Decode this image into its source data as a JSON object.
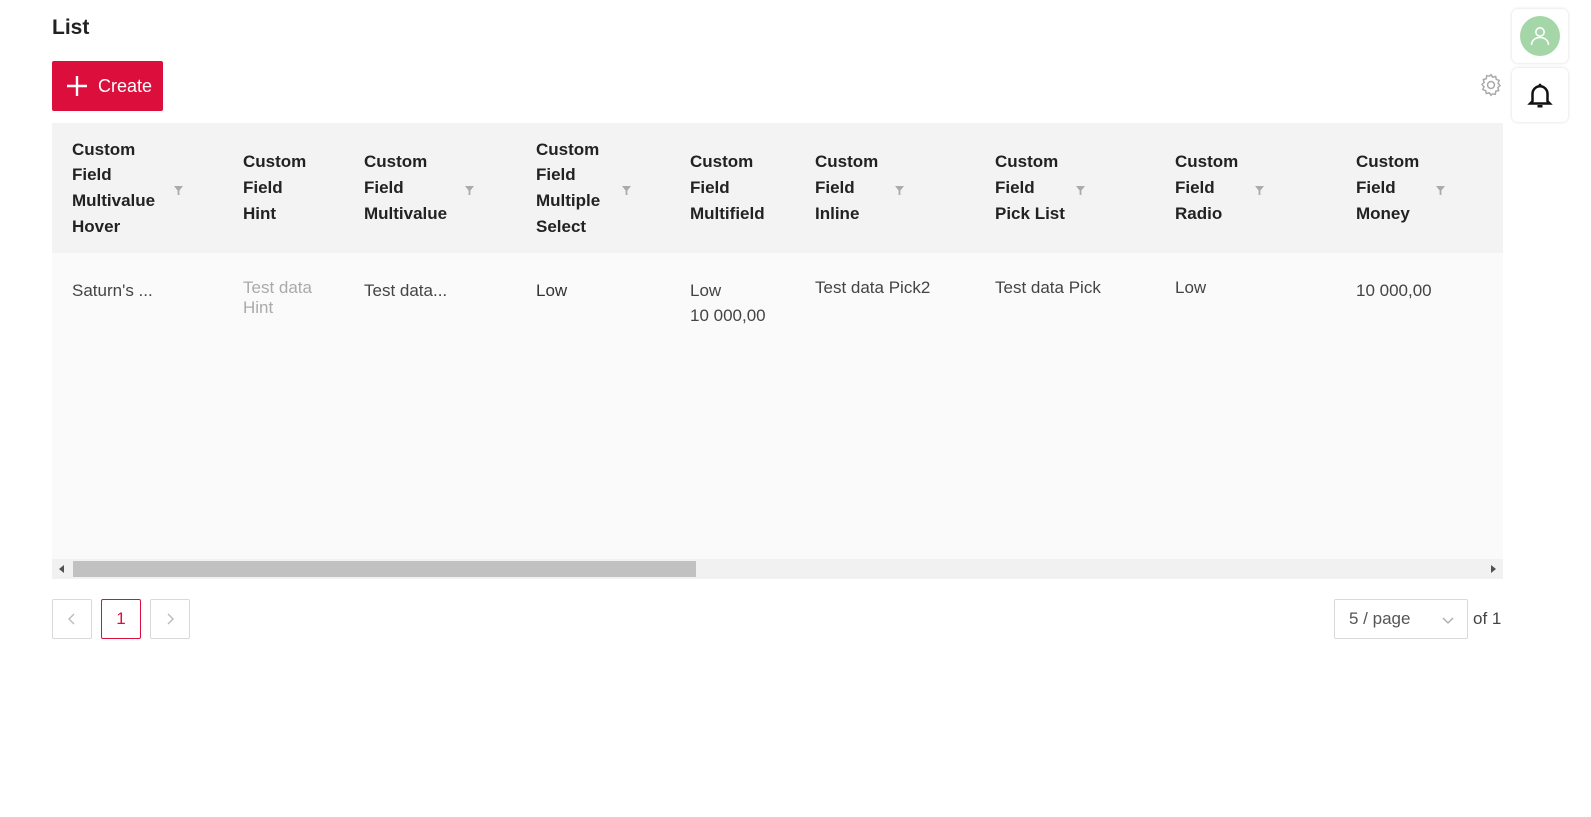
{
  "page": {
    "title": "List"
  },
  "toolbar": {
    "create_label": "Create"
  },
  "table": {
    "columns": [
      {
        "label": "Custom\nField\nMultivalue\nHover",
        "filterable": true
      },
      {
        "label": "Custom\nField\nHint",
        "filterable": false
      },
      {
        "label": "Custom\nField\nMultivalue",
        "filterable": true
      },
      {
        "label": "Custom\nField\nMultiple\nSelect",
        "filterable": true
      },
      {
        "label": "Custom\nField\nMultifield",
        "filterable": false
      },
      {
        "label": "Custom\nField\nInline",
        "filterable": true
      },
      {
        "label": "Custom\nField\nPick List",
        "filterable": true
      },
      {
        "label": "Custom\nField\nRadio",
        "filterable": true
      },
      {
        "label": "Custom\nField\nMoney",
        "filterable": true
      }
    ],
    "rows": [
      {
        "cells": [
          "Saturn's ...",
          "Test data\nHint",
          "Test data...",
          "Low",
          "Low\n10 000,00",
          "Test data Pick2",
          "Test data Pick",
          "Low",
          "10 000,00"
        ]
      }
    ]
  },
  "pagination": {
    "prev_icon": "chevron-left-icon",
    "current_page": "1",
    "next_icon": "chevron-right-icon",
    "page_size": "5 / page",
    "of_label": "of 1"
  },
  "icons": {
    "create": "plus-icon",
    "settings": "gear-icon",
    "user": "user-icon",
    "notifications": "bell-icon",
    "filter": "filter-icon"
  },
  "colors": {
    "accent": "#dc0f3c",
    "avatar_bg": "#a5d6a7",
    "header_bg": "#f3f3f3",
    "body_bg": "#fafafa"
  }
}
